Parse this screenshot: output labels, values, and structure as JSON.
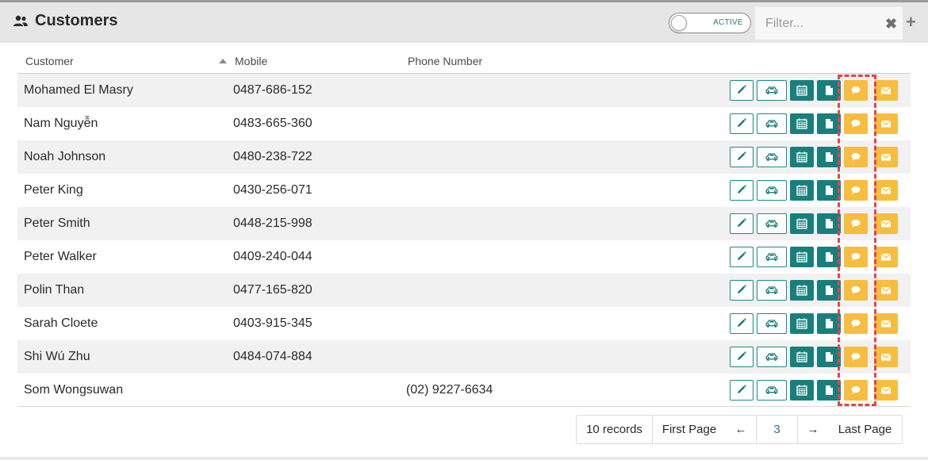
{
  "header": {
    "title": "Customers",
    "toggle_label": "ACTIVE",
    "filter_placeholder": "Filter...",
    "clear_symbol": "✖",
    "add_symbol": "+"
  },
  "table": {
    "columns": [
      "Customer",
      "Mobile",
      "Phone Number"
    ],
    "sorted_column": "Customer",
    "rows": [
      {
        "customer": "Mohamed El Masry",
        "mobile": "0487-686-152",
        "phone": ""
      },
      {
        "customer": "Nam Nguyễn",
        "mobile": "0483-665-360",
        "phone": ""
      },
      {
        "customer": "Noah Johnson",
        "mobile": "0480-238-722",
        "phone": ""
      },
      {
        "customer": "Peter King",
        "mobile": "0430-256-071",
        "phone": ""
      },
      {
        "customer": "Peter Smith",
        "mobile": "0448-215-998",
        "phone": ""
      },
      {
        "customer": "Peter Walker",
        "mobile": "0409-240-044",
        "phone": ""
      },
      {
        "customer": "Polin Than",
        "mobile": "0477-165-820",
        "phone": ""
      },
      {
        "customer": "Sarah Cloete",
        "mobile": "0403-915-345",
        "phone": ""
      },
      {
        "customer": "Shi Wú Zhu",
        "mobile": "0484-074-884",
        "phone": ""
      },
      {
        "customer": "Som Wongsuwan",
        "mobile": "",
        "phone": "(02) 9227-6634"
      }
    ],
    "row_actions": [
      "pencil-icon",
      "car-icon",
      "calendar-icon",
      "document-icon",
      "chat-icon",
      "envelope-icon"
    ]
  },
  "pagination": {
    "records": "10 records",
    "first": "First Page",
    "prev": "←",
    "current": "3",
    "next": "→",
    "last": "Last Page"
  },
  "colors": {
    "teal": "#187f7c",
    "yellow": "#f6bd3f",
    "highlight": "#e0454a"
  }
}
